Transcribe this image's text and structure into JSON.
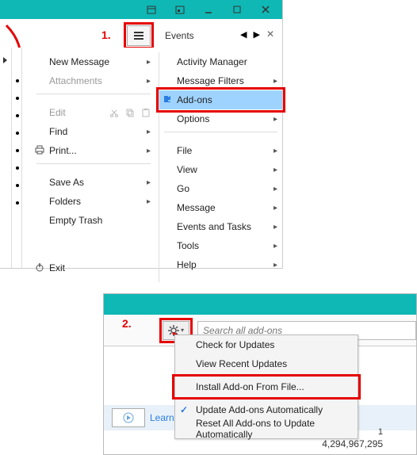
{
  "top": {
    "step_label": "1.",
    "events": "Events",
    "col1": {
      "new_message": "New Message",
      "attachments": "Attachments",
      "edit": "Edit",
      "find": "Find",
      "print": "Print...",
      "save_as": "Save As",
      "folders": "Folders",
      "empty_trash": "Empty Trash",
      "exit": "Exit"
    },
    "col2": {
      "activity_manager": "Activity Manager",
      "message_filters": "Message Filters",
      "addons": "Add-ons",
      "options": "Options",
      "file": "File",
      "view": "View",
      "go": "Go",
      "message": "Message",
      "events_tasks": "Events and Tasks",
      "tools": "Tools",
      "help": "Help"
    }
  },
  "bottom": {
    "step_label": "2.",
    "search_placeholder": "Search all add-ons",
    "menu": {
      "check_updates": "Check for Updates",
      "view_recent": "View Recent Updates",
      "install_from_file": "Install Add-on From File...",
      "update_auto": "Update Add-ons Automatically",
      "reset_auto": "Reset All Add-ons to Update Automatically"
    },
    "learn": "Learn",
    "count_small": "1",
    "count_big": "4,294,967,295"
  }
}
